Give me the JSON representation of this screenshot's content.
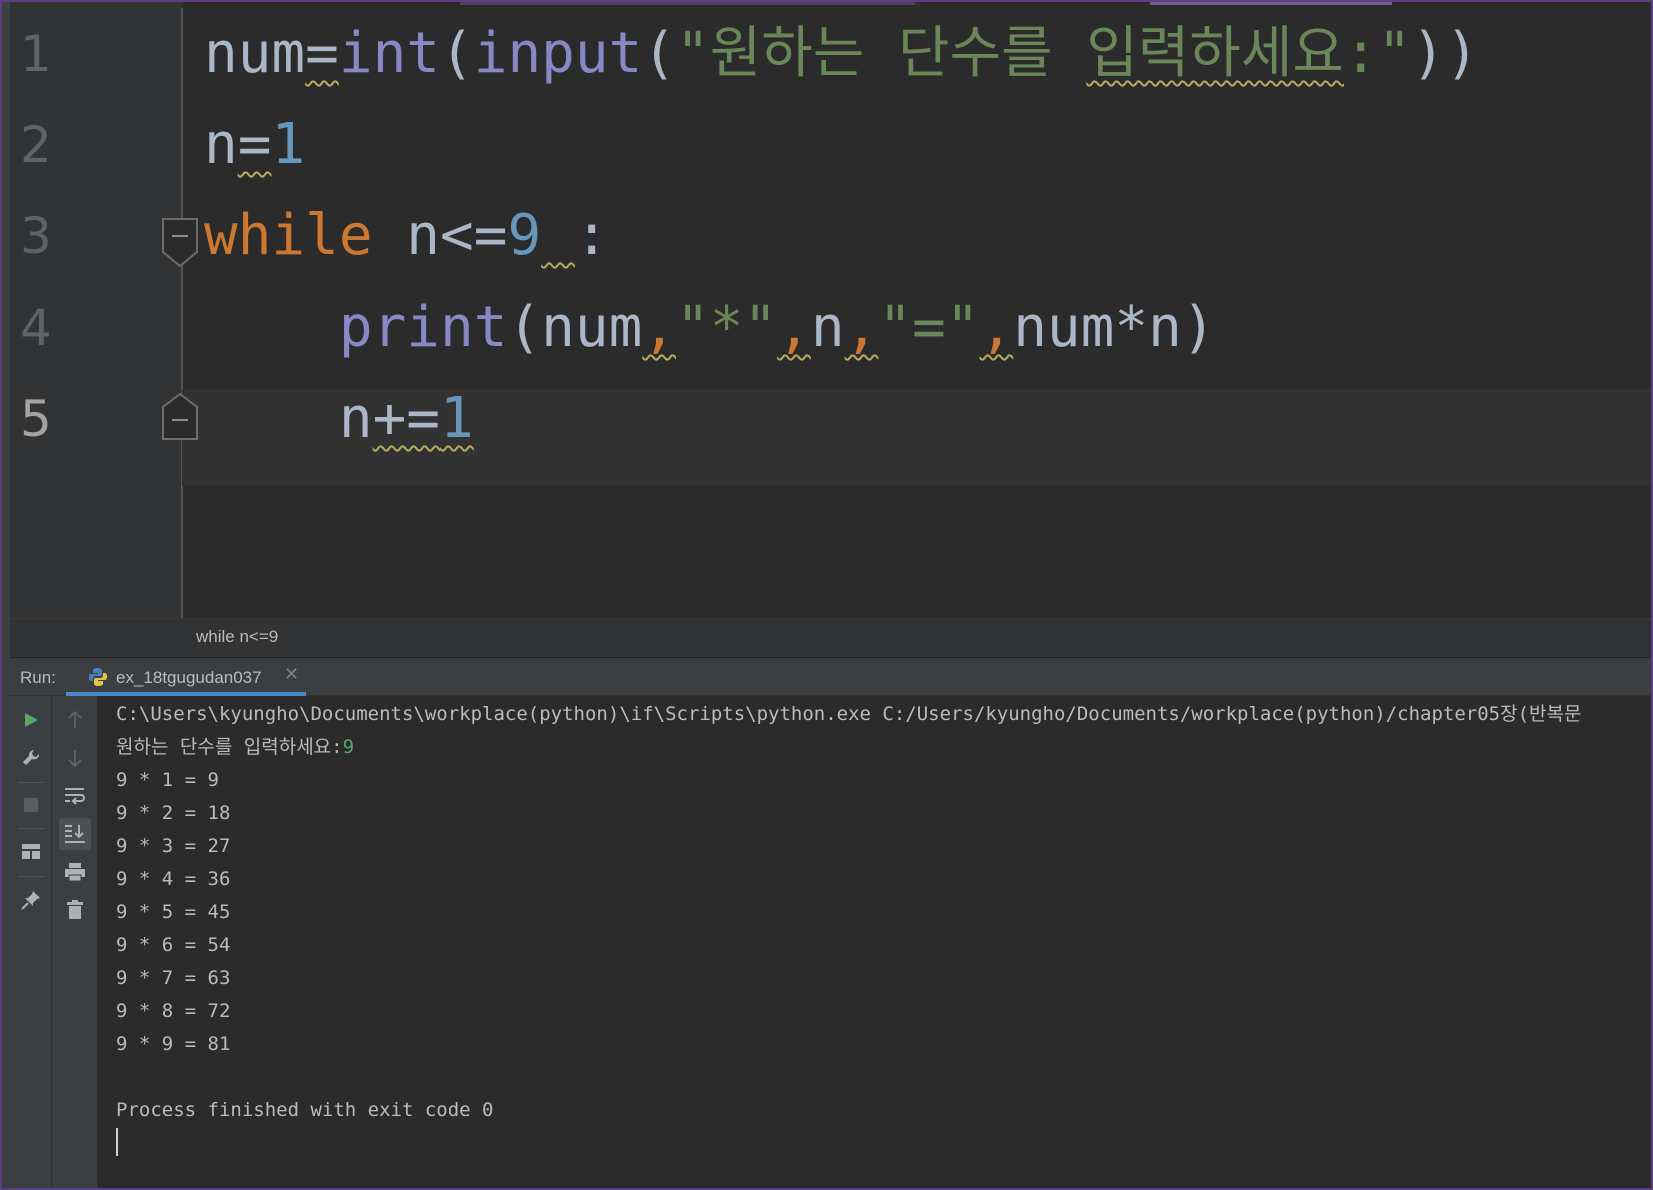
{
  "editor": {
    "line_numbers": [
      "1",
      "2",
      "3",
      "4",
      "5"
    ],
    "lines": [
      {
        "tokens": [
          {
            "t": "num",
            "c": "",
            "w": false
          },
          {
            "t": "=",
            "c": "",
            "w": true
          },
          {
            "t": "int",
            "c": "bi",
            "w": false
          },
          {
            "t": "(",
            "c": "",
            "w": false
          },
          {
            "t": "input",
            "c": "bi",
            "w": false
          },
          {
            "t": "(",
            "c": "",
            "w": false
          },
          {
            "t": "\"원하는 단수를 ",
            "c": "str",
            "w": false
          },
          {
            "t": "입력하세요",
            "c": "str",
            "w": true
          },
          {
            "t": ":\"",
            "c": "str",
            "w": false
          },
          {
            "t": "))",
            "c": "",
            "w": false
          }
        ]
      },
      {
        "tokens": [
          {
            "t": "n",
            "c": "",
            "w": false
          },
          {
            "t": "=",
            "c": "",
            "w": true
          },
          {
            "t": "1",
            "c": "num",
            "w": false
          }
        ]
      },
      {
        "tokens": [
          {
            "t": "while",
            "c": "kw",
            "w": false
          },
          {
            "t": " ",
            "c": "",
            "w": false
          },
          {
            "t": "n<",
            "c": "",
            "w": false
          },
          {
            "t": "<=",
            "c": "",
            "w": true,
            "hide": true
          },
          {
            "t": "=",
            "c": "",
            "w": false
          },
          {
            "t": "9",
            "c": "num",
            "w": false
          },
          {
            "t": " ",
            "c": "",
            "w": true
          },
          {
            "t": ":",
            "c": "",
            "w": false
          }
        ]
      },
      {
        "tokens": [
          {
            "t": "    ",
            "c": "",
            "w": false
          },
          {
            "t": "print",
            "c": "bi",
            "w": false
          },
          {
            "t": "(num",
            "c": "",
            "w": false
          },
          {
            "t": ",",
            "c": "punc",
            "w": true
          },
          {
            "t": "\"*\"",
            "c": "str",
            "w": false
          },
          {
            "t": ",",
            "c": "punc",
            "w": true
          },
          {
            "t": "n",
            "c": "",
            "w": false
          },
          {
            "t": ",",
            "c": "punc",
            "w": true
          },
          {
            "t": "\"=\"",
            "c": "str",
            "w": false
          },
          {
            "t": ",",
            "c": "punc",
            "w": true
          },
          {
            "t": "num*n)",
            "c": "",
            "w": false
          }
        ]
      },
      {
        "tokens": [
          {
            "t": "    ",
            "c": "",
            "w": false
          },
          {
            "t": "n",
            "c": "",
            "w": false
          },
          {
            "t": "+=",
            "c": "",
            "w": true
          },
          {
            "t": "1",
            "c": "num",
            "w": true
          }
        ]
      }
    ],
    "breadcrumb": "while n<=9"
  },
  "run_panel": {
    "label": "Run:",
    "tab_label": "ex_18tgugudan037",
    "tab_close": "✕",
    "console": {
      "command": "C:\\Users\\kyungho\\Documents\\workplace(python)\\if\\Scripts\\python.exe C:/Users/kyungho/Documents/workplace(python)/chapter05장(반복문",
      "prompt": "원하는 단수를 입력하세요:",
      "input_value": "9",
      "output": [
        "9 * 1 = 9",
        "9 * 2 = 18",
        "9 * 3 = 27",
        "9 * 4 = 36",
        "9 * 5 = 45",
        "9 * 6 = 54",
        "9 * 7 = 63",
        "9 * 8 = 72",
        "9 * 9 = 81"
      ],
      "finish": "Process finished with exit code 0"
    }
  },
  "colors": {
    "keyword": "#cc7832",
    "builtin": "#8888c6",
    "string": "#6a8759",
    "number": "#6897bb",
    "text": "#a9b7c6",
    "user_input": "#59a869",
    "run_green": "#59a869"
  },
  "icons": {
    "toolbar1": [
      "run-icon",
      "wrench-icon",
      "stop-icon",
      "layout-icon",
      "pin-icon"
    ],
    "toolbar2": [
      "up-arrow-icon",
      "down-arrow-icon",
      "soft-wrap-icon",
      "scroll-to-end-icon",
      "print-icon",
      "trash-icon"
    ]
  }
}
